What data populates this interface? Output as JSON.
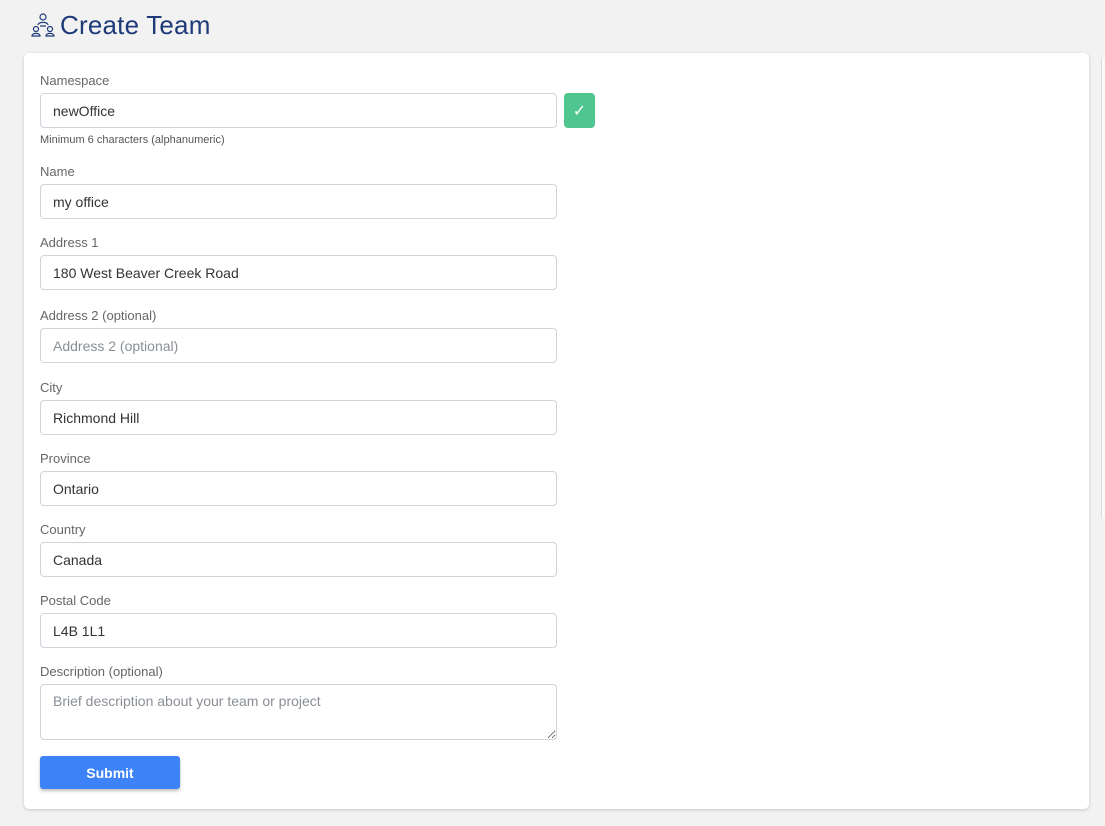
{
  "header": {
    "title": "Create Team",
    "icon": "team-icon"
  },
  "form": {
    "namespace": {
      "label": "Namespace",
      "value": "newOffice",
      "hint": "Minimum 6 characters (alphanumeric)",
      "check": "✓"
    },
    "name": {
      "label": "Name",
      "value": "my office"
    },
    "address1": {
      "label": "Address 1",
      "value": "180 West Beaver Creek Road"
    },
    "address2": {
      "label": "Address 2 (optional)",
      "value": "",
      "placeholder": "Address 2 (optional)"
    },
    "city": {
      "label": "City",
      "value": "Richmond Hill"
    },
    "province": {
      "label": "Province",
      "value": "Ontario"
    },
    "country": {
      "label": "Country",
      "value": "Canada"
    },
    "postal": {
      "label": "Postal Code",
      "value": "L4B 1L1"
    },
    "description": {
      "label": "Description (optional)",
      "value": "",
      "placeholder": "Brief description about your team or project"
    },
    "submit_label": "Submit"
  },
  "colors": {
    "accent": "#3d82f7",
    "success": "#4fc58f",
    "title": "#1e3a78"
  }
}
